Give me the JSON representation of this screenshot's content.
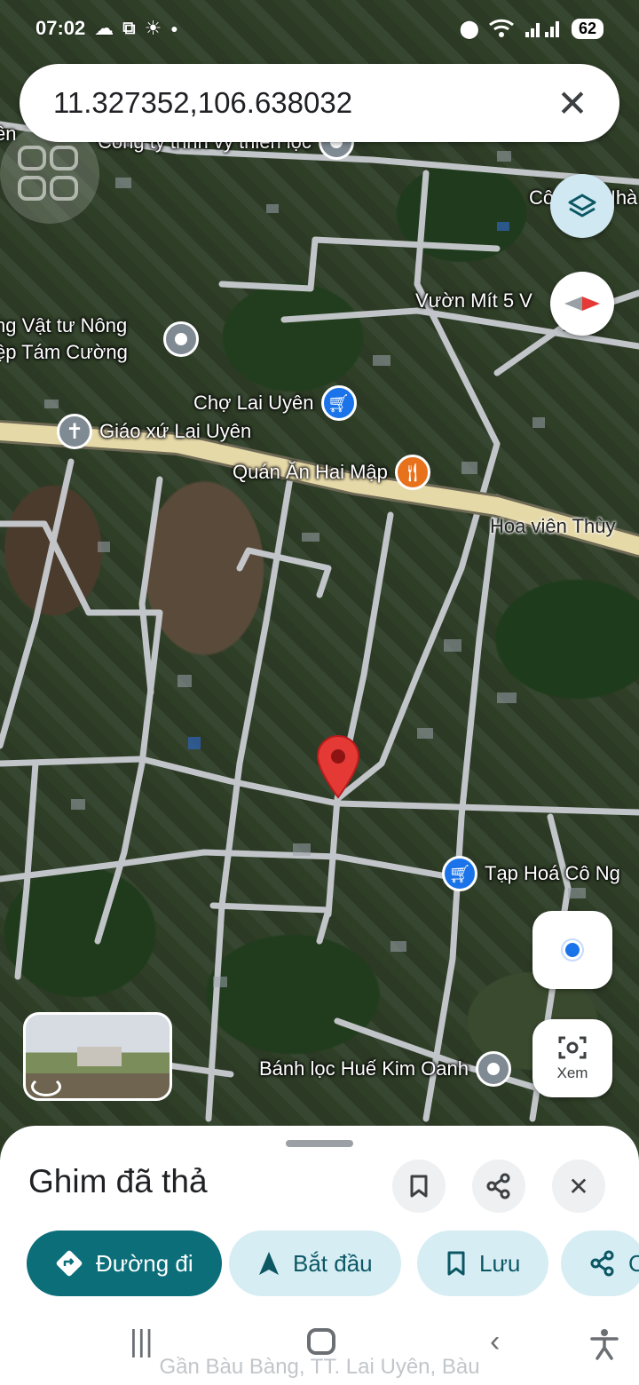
{
  "status_bar": {
    "time": "07:02",
    "battery": "62",
    "icons": [
      "cloud-icon",
      "screenshot-icon",
      "sun-icon",
      "dot-icon",
      "location-icon",
      "wifi-icon",
      "signal-icon"
    ]
  },
  "search": {
    "query": "11.327352,106.638032",
    "close_icon": "close-icon"
  },
  "map": {
    "road_label": "Hoa viên Thùy",
    "places": [
      {
        "name": "Công ty tnhh vy thiên lộc",
        "icon": "gray-pin"
      },
      {
        "name": "Công ty Nhà D",
        "icon": "gray-pin"
      },
      {
        "name": "Vườn Mít 5 V",
        "icon": "gray-pin"
      },
      {
        "name": "ng Vật tư Nông",
        "icon": "gray-pin"
      },
      {
        "name": "ệp Tám Cường",
        "icon": "gray-pin"
      },
      {
        "name": "Chợ Lai Uyên",
        "icon": "cart-icon"
      },
      {
        "name": "Giáo xứ Lai Uyên",
        "icon": "cross-icon"
      },
      {
        "name": "Quán Ăn Hai Mập",
        "icon": "fork-knife-icon"
      },
      {
        "name": "Tạp Hoá Cô Ng",
        "icon": "cart-icon"
      },
      {
        "name": "Bánh lọc Huế Kim Oanh",
        "icon": "gray-pin"
      }
    ],
    "colors": {
      "road_main": "#e6d9a8",
      "road": "#c9ccd1",
      "pin_red": "#e53935",
      "accent": "#1a73e8"
    }
  },
  "controls": {
    "lens_label": "Xem"
  },
  "sheet": {
    "title": "Ghim đã thả",
    "chips": [
      {
        "label": "Đường đi",
        "icon": "directions-icon"
      },
      {
        "label": "Bắt đầu",
        "icon": "navigation-arrow-icon"
      },
      {
        "label": "Lưu",
        "icon": "bookmark-icon"
      },
      {
        "label": "C",
        "icon": "share-icon"
      }
    ],
    "colors": {
      "primary_chip": "#0b6e79",
      "secondary_chip": "#d7edf4"
    }
  },
  "nav": {
    "behind_text": "Gần Bàu Bàng, TT. Lai Uyên, Bàu"
  }
}
